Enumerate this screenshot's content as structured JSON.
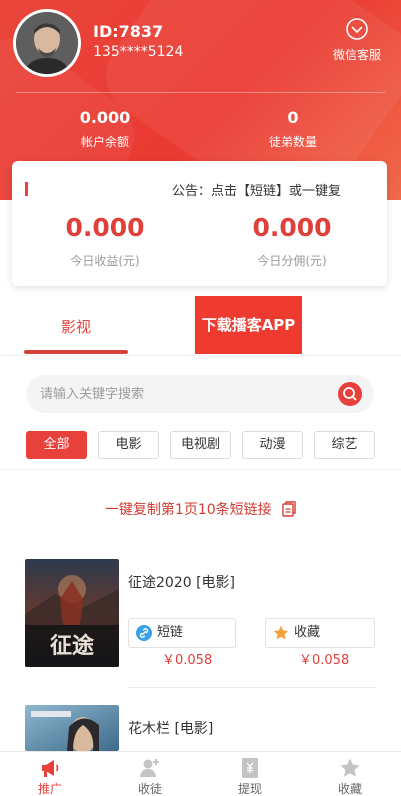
{
  "user": {
    "id": "ID:7837",
    "phone": "135****5124",
    "service_label": "微信客服"
  },
  "stats": {
    "balance_value": "0.000",
    "balance_label": "帐户余额",
    "disciples_value": "0",
    "disciples_label": "徒弟数量"
  },
  "notice": "公告：点击【短链】或一键复",
  "earnings": {
    "today_income_value": "0.000",
    "today_income_label": "今日收益(元)",
    "today_commission_value": "0.000",
    "today_commission_label": "今日分佣(元)"
  },
  "tabs": {
    "video": "影视",
    "download": "下载播客APP"
  },
  "search": {
    "placeholder": "请输入关键字搜索"
  },
  "categories": [
    "全部",
    "电影",
    "电视剧",
    "动漫",
    "综艺"
  ],
  "copy_link": "一键复制第1页10条短链接",
  "items": [
    {
      "title": "征途2020 [电影]",
      "short_link_label": "短链",
      "short_link_price": "￥0.058",
      "collect_label": "收藏",
      "collect_price": "￥0.058",
      "poster_text": "征途"
    },
    {
      "title": "花木栏 [电影]"
    }
  ],
  "bottom_nav": {
    "promote": "推广",
    "recruit": "收徒",
    "withdraw": "提现",
    "favorites": "收藏"
  },
  "colors": {
    "accent": "#e8403a",
    "header": "#ea3a32"
  }
}
